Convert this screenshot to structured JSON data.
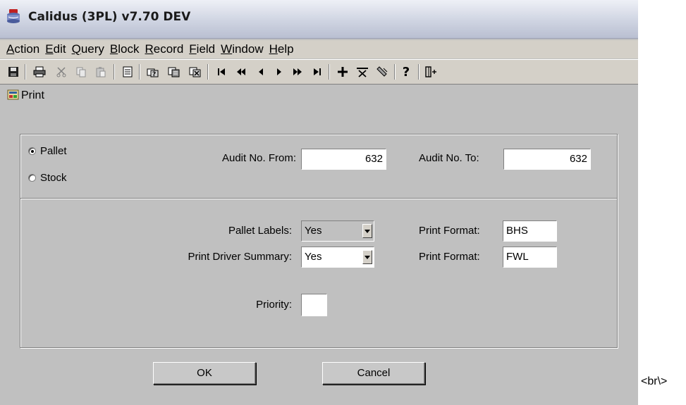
{
  "window": {
    "title": "Calidus (3PL) v7.70 DEV",
    "icon": "oracle-forms-app-icon"
  },
  "menu": {
    "items": [
      {
        "accel": "A",
        "rest": "ction"
      },
      {
        "accel": "E",
        "rest": "dit"
      },
      {
        "accel": "Q",
        "rest": "uery"
      },
      {
        "accel": "B",
        "rest": "lock"
      },
      {
        "accel": "R",
        "rest": "ecord"
      },
      {
        "accel": "F",
        "rest": "ield"
      },
      {
        "accel": "W",
        "rest": "indow"
      },
      {
        "accel": "H",
        "rest": "elp"
      }
    ]
  },
  "toolbar": {
    "icons": [
      "save-icon",
      "print-icon",
      "cut-icon",
      "copy-icon",
      "paste-icon",
      "edit-icon",
      "enter-query-icon",
      "execute-query-icon",
      "cancel-query-icon",
      "first-record-icon",
      "previous-block-icon",
      "previous-record-icon",
      "next-record-icon",
      "next-block-icon",
      "last-record-icon",
      "insert-record-icon",
      "delete-record-icon",
      "clear-record-icon",
      "help-icon",
      "exit-icon"
    ],
    "help_glyph": "?"
  },
  "form": {
    "title": "Print",
    "type_options": {
      "pallet": "Pallet",
      "stock": "Stock",
      "selected": "Pallet"
    },
    "audit_from": {
      "label": "Audit No. From:",
      "value": "632"
    },
    "audit_to": {
      "label": "Audit No. To:",
      "value": "632"
    },
    "pallet_labels": {
      "label": "Pallet Labels:",
      "value": "Yes"
    },
    "print_driver_summary": {
      "label": "Print Driver Summary:",
      "value": "Yes"
    },
    "print_format_1": {
      "label": "Print Format:",
      "value": "BHS"
    },
    "print_format_2": {
      "label": "Print Format:",
      "value": "FWL"
    },
    "priority": {
      "label": "Priority:",
      "value": ""
    }
  },
  "buttons": {
    "ok": "OK",
    "cancel": "Cancel"
  },
  "stray_text": "<br\\>"
}
